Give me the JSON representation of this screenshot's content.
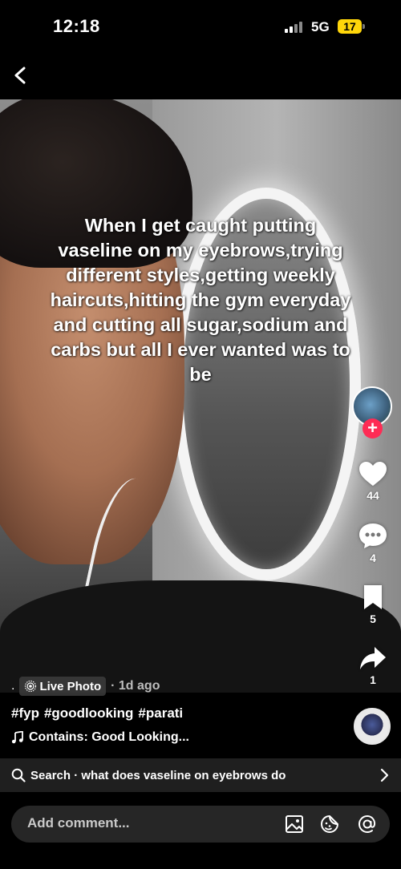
{
  "status": {
    "time": "12:18",
    "network": "5G",
    "battery": "17"
  },
  "video": {
    "overlay_text": "When I get  caught putting vaseline on my eyebrows,trying different styles,getting weekly haircuts,hitting the gym everyday and cutting all sugar,sodium and carbs but all I ever wanted was to be"
  },
  "actions": {
    "likes": "44",
    "comments": "4",
    "saves": "5",
    "shares": "1"
  },
  "post": {
    "dot": ".",
    "badge": "Live Photo",
    "time_ago": "· 1d ago",
    "hashtags": [
      "#fyp",
      "#goodlooking",
      "#parati"
    ],
    "music": "Contains: Good Looking..."
  },
  "search": {
    "label": "Search · what does vaseline on eyebrows do"
  },
  "comment": {
    "placeholder": "Add comment..."
  },
  "colors": {
    "accent": "#fe2c55",
    "battery": "#ffd60a"
  }
}
